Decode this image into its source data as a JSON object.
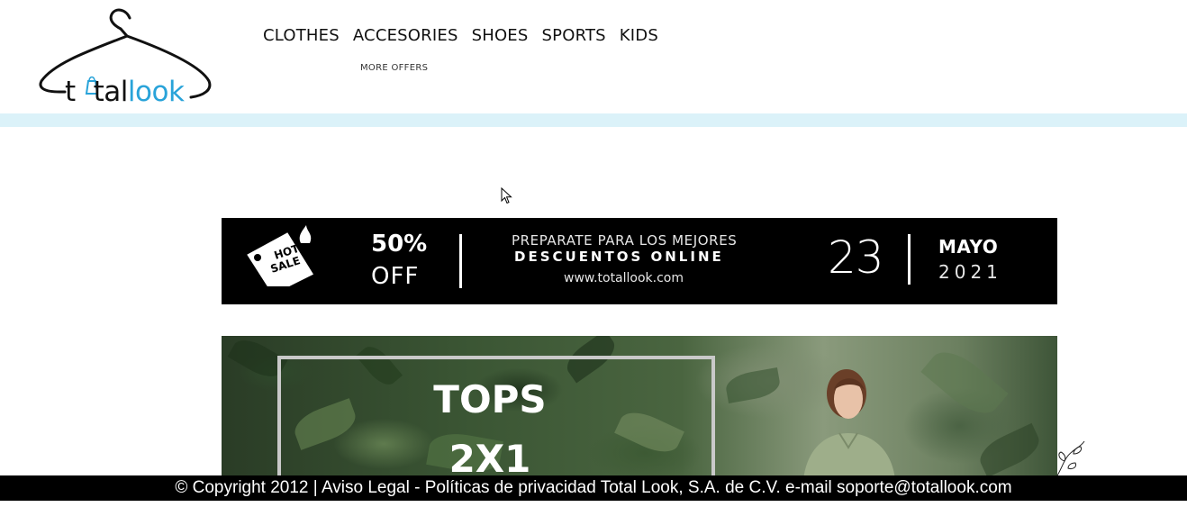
{
  "brand": {
    "logo_text_dark": "t",
    "logo_text_dark2": "tal",
    "logo_text_blue": "look",
    "accent_color": "#29a3d9"
  },
  "nav": {
    "items": [
      {
        "label": "CLOTHES"
      },
      {
        "label": "ACCESORIES"
      },
      {
        "label": "SHOES"
      },
      {
        "label": "SPORTS"
      },
      {
        "label": "KIDS"
      }
    ],
    "more_offers": "MORE OFFERS"
  },
  "hot_sale_banner": {
    "tag_line1": "HOT",
    "tag_line2": "SALE",
    "discount": "50%",
    "off": "OFF",
    "headline": "PREPARATE PARA LOS MEJORES",
    "subheadline": "DESCUENTOS ONLINE",
    "website": "www.totallook.com",
    "day": "23",
    "month": "MAYO",
    "year": "2021"
  },
  "tops_banner": {
    "title": "TOPS",
    "deal": "2X1"
  },
  "footer": {
    "text": "© Copyright 2012 | Aviso Legal - Políticas de privacidad Total Look, S.A. de C.V. e-mail soporte@totallook.com"
  },
  "colors": {
    "stripe": "#dbf2f9",
    "banner_bg": "#000000"
  }
}
